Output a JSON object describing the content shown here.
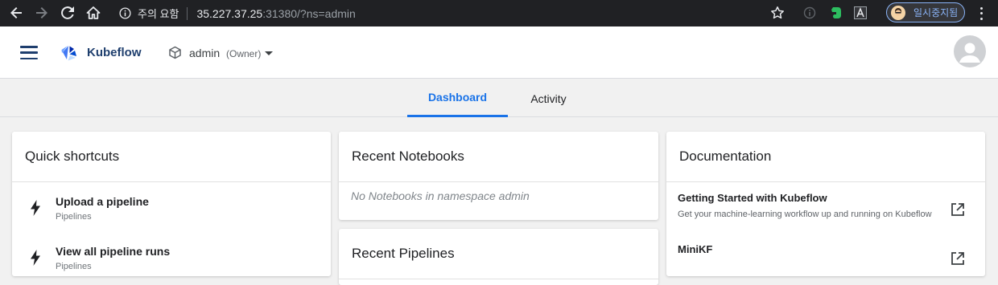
{
  "browser": {
    "url_warning": "주의 요함",
    "url_host": "35.227.37.25",
    "url_rest": ":31380/?ns=admin",
    "profile_label": "일시중지됨"
  },
  "header": {
    "brand": "Kubeflow",
    "namespace": "admin",
    "role": "(Owner)"
  },
  "tabs": [
    {
      "label": "Dashboard",
      "active": true
    },
    {
      "label": "Activity",
      "active": false
    }
  ],
  "quick_shortcuts": {
    "title": "Quick shortcuts",
    "items": [
      {
        "title": "Upload a pipeline",
        "subtitle": "Pipelines"
      },
      {
        "title": "View all pipeline runs",
        "subtitle": "Pipelines"
      }
    ]
  },
  "recent_notebooks": {
    "title": "Recent Notebooks",
    "empty_message": "No Notebooks in namespace admin"
  },
  "recent_pipelines": {
    "title": "Recent Pipelines"
  },
  "documentation": {
    "title": "Documentation",
    "items": [
      {
        "title": "Getting Started with Kubeflow",
        "description": "Get your machine-learning workflow up and running on Kubeflow"
      },
      {
        "title": "MiniKF",
        "description": ""
      }
    ]
  },
  "colors": {
    "accent": "#1a73e8",
    "brand_navy": "#1f3f6e",
    "chrome_dark": "#202124"
  }
}
